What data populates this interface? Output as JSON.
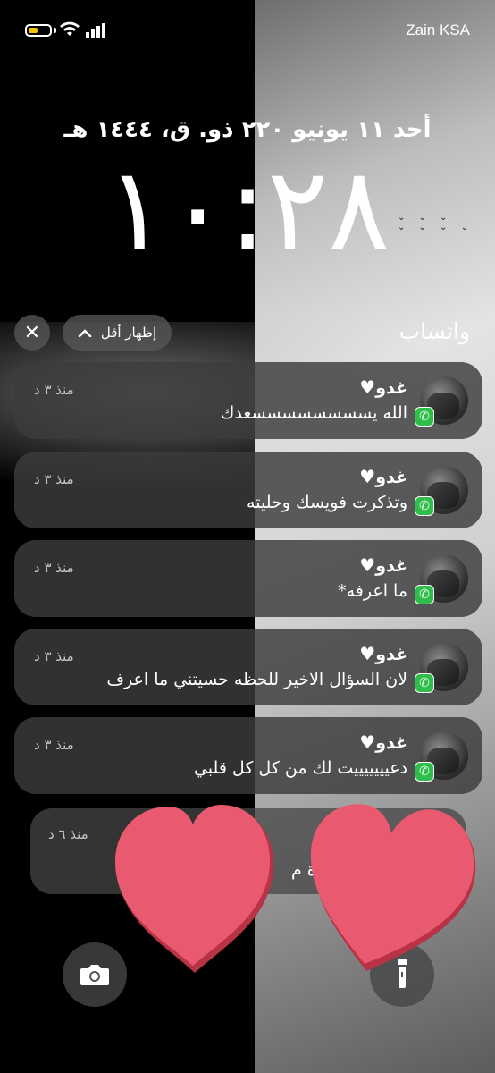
{
  "status_bar": {
    "carrier": "Zain KSA",
    "battery_level": 0.45,
    "battery_color": "#f5c400"
  },
  "lock_screen": {
    "date": "أحد ١١ يونيو ٢٢٠ ذو. ق، ١٤٤٤ هـ",
    "time": "١٠:٢٨"
  },
  "notification_group": {
    "app_name": "واتساب",
    "show_less_label": "إظهار أقل",
    "close_icon": "close-icon",
    "chevron_icon": "chevron-up-icon",
    "notifications": [
      {
        "sender": "غدو",
        "message": "الله يسسسسسسسسعدك",
        "time": "منذ ٣ د"
      },
      {
        "sender": "غدو",
        "message": "وتذكرت فويسك وحليته",
        "time": "منذ ٣ د"
      },
      {
        "sender": "غدو",
        "message": "ما اعرفه*",
        "time": "منذ ٣ د"
      },
      {
        "sender": "غدو",
        "message": "لان السؤال الاخير للحظه حسيتني ما اعرف",
        "time": "منذ ٣ د"
      },
      {
        "sender": "غدو",
        "message": "دعيييييييت لك من كل كل قلبي",
        "time": "منذ ٣ د"
      }
    ],
    "stacked": {
      "time": "منذ ٦ د",
      "message_fragment": "ـدة م"
    }
  },
  "controls": {
    "camera_icon": "camera-icon",
    "flashlight_icon": "flashlight-icon"
  },
  "colors": {
    "whatsapp": "#2fbe4a",
    "heart_sticker": "#e95a70"
  }
}
